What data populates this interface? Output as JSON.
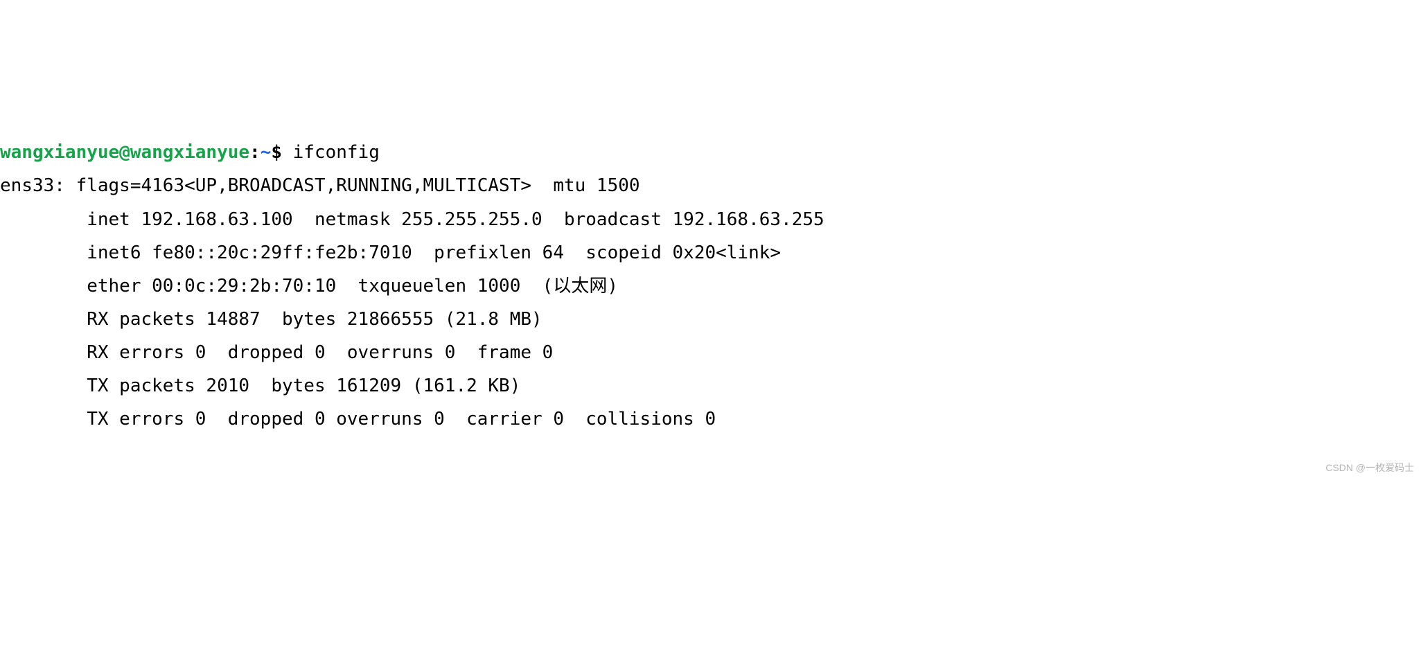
{
  "prompt": {
    "user_host": "wangxianyue@wangxianyue",
    "separator": ":",
    "path": "~",
    "dollar": "$"
  },
  "command": "ifconfig",
  "output": {
    "l1": "ens33: flags=4163<UP,BROADCAST,RUNNING,MULTICAST>  mtu 1500",
    "l2": "        inet 192.168.63.100  netmask 255.255.255.0  broadcast 192.168.63.255",
    "l3": "        inet6 fe80::20c:29ff:fe2b:7010  prefixlen 64  scopeid 0x20<link>",
    "l4": "        ether 00:0c:29:2b:70:10  txqueuelen 1000  (以太网)",
    "l5": "        RX packets 14887  bytes 21866555 (21.8 MB)",
    "l6": "        RX errors 0  dropped 0  overruns 0  frame 0",
    "l7": "        TX packets 2010  bytes 161209 (161.2 KB)",
    "l8": "        TX errors 0  dropped 0 overruns 0  carrier 0  collisions 0"
  },
  "watermark": "CSDN @一枚爱码士"
}
